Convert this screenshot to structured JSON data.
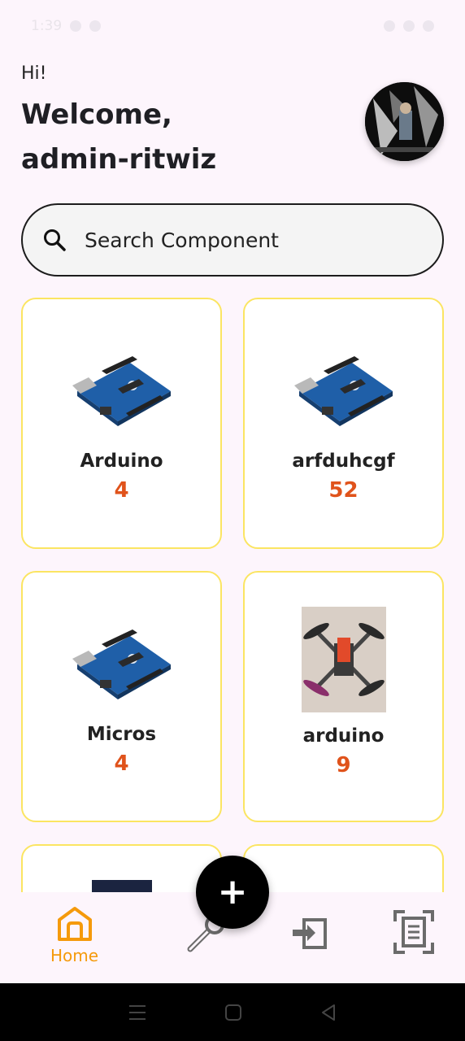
{
  "status_bar": {
    "time": "1:39"
  },
  "header": {
    "greeting": "Hi!",
    "welcome_line1": "Welcome,",
    "welcome_line2": "admin-ritwiz"
  },
  "search": {
    "placeholder": "Search Component",
    "icon": "search-icon"
  },
  "components": [
    {
      "name": "Arduino",
      "count": "4",
      "image": "arduino-board"
    },
    {
      "name": "arfduhcgf",
      "count": "52",
      "image": "arduino-board"
    },
    {
      "name": "Micros",
      "count": "4",
      "image": "arduino-board"
    },
    {
      "name": "arduino",
      "count": "9",
      "image": "drone-photo"
    }
  ],
  "fab": {
    "label": "+"
  },
  "bottom_nav": {
    "items": [
      {
        "label": "Home",
        "icon": "home-icon",
        "active": true
      },
      {
        "label": "",
        "icon": "tools-icon",
        "active": false
      },
      {
        "label": "",
        "icon": "transfer-icon",
        "active": false
      },
      {
        "label": "",
        "icon": "scan-document-icon",
        "active": false
      }
    ]
  },
  "colors": {
    "background": "#fdf5fc",
    "card_border": "#fbe562",
    "count": "#e0531b",
    "nav_active": "#f59a0b",
    "fab": "#000000"
  }
}
